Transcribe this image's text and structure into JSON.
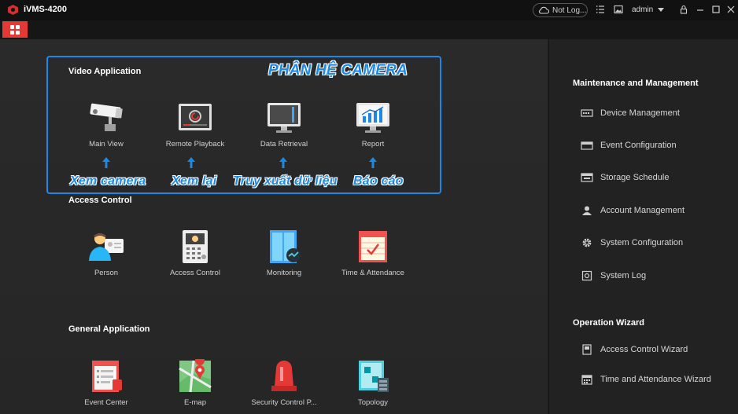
{
  "titlebar": {
    "app_title": "iVMS-4200",
    "cloud_status": "Not Log...",
    "user": "admin"
  },
  "video_section": {
    "title": "Video Application",
    "apps": [
      {
        "label": "Main View",
        "icon": "camera-icon"
      },
      {
        "label": "Remote Playback",
        "icon": "playback-icon"
      },
      {
        "label": "Data Retrieval",
        "icon": "monitor-icon"
      },
      {
        "label": "Report",
        "icon": "bar-chart-icon"
      }
    ]
  },
  "annotations": {
    "title": "PHÂN HỆ CAMERA",
    "labels": [
      "Xem camera",
      "Xem lại",
      "Truy xuất dữ liệu",
      "Báo cáo"
    ]
  },
  "access_section": {
    "title": "Access Control",
    "apps": [
      {
        "label": "Person",
        "icon": "person-icon"
      },
      {
        "label": "Access Control",
        "icon": "door-station-icon"
      },
      {
        "label": "Monitoring",
        "icon": "door-monitor-icon"
      },
      {
        "label": "Time & Attendance",
        "icon": "calendar-icon"
      }
    ]
  },
  "general_section": {
    "title": "General Application",
    "apps": [
      {
        "label": "Event Center",
        "icon": "event-icon"
      },
      {
        "label": "E-map",
        "icon": "map-icon"
      },
      {
        "label": "Security Control P...",
        "icon": "alarm-light-icon"
      },
      {
        "label": "Topology",
        "icon": "topology-icon"
      }
    ]
  },
  "maintenance": {
    "title": "Maintenance and Management",
    "items": [
      {
        "label": "Device Management",
        "icon": "device-icon"
      },
      {
        "label": "Event Configuration",
        "icon": "event-config-icon"
      },
      {
        "label": "Storage Schedule",
        "icon": "storage-icon"
      },
      {
        "label": "Account Management",
        "icon": "account-icon"
      },
      {
        "label": "System Configuration",
        "icon": "gear-icon"
      },
      {
        "label": "System Log",
        "icon": "log-icon"
      }
    ]
  },
  "wizard": {
    "title": "Operation Wizard",
    "items": [
      {
        "label": "Access Control Wizard",
        "icon": "wizard-icon"
      },
      {
        "label": "Time and Attendance Wizard",
        "icon": "calendar-wizard-icon"
      }
    ]
  },
  "colors": {
    "accent": "#e53935",
    "annotation": "#1e88e5"
  }
}
